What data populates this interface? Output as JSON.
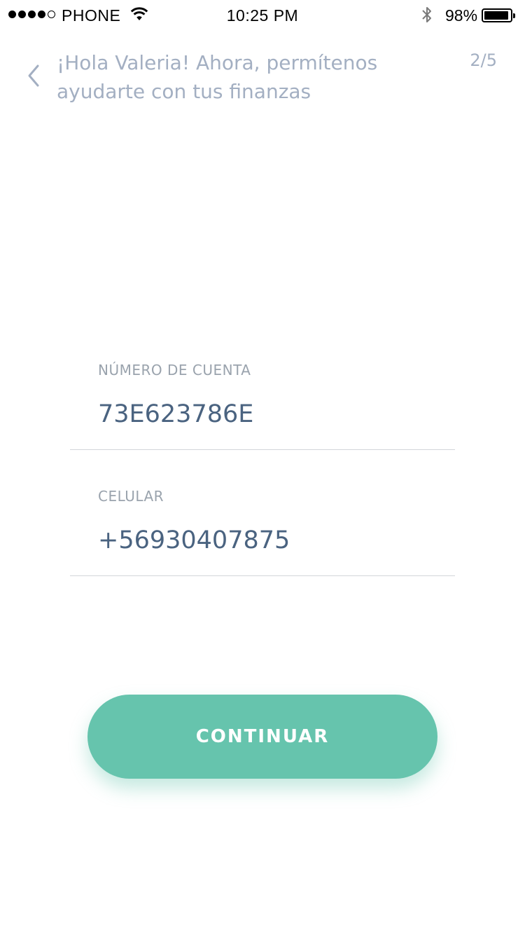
{
  "status_bar": {
    "carrier": "PHONE",
    "time": "10:25 PM",
    "battery_percent": "98%",
    "signal_dots_filled": 4,
    "signal_dots_total": 5,
    "battery_level": 0.98
  },
  "header": {
    "title": "¡Hola Valeria! Ahora, permítenos ayudarte con tus finanzas",
    "step": "2/5",
    "back_icon": "chevron-left-icon"
  },
  "form": {
    "account": {
      "label": "NÚMERO DE CUENTA",
      "value": "73E623786E"
    },
    "phone": {
      "label": "CELULAR",
      "value": "+56930407875"
    }
  },
  "actions": {
    "continue_label": "CONTINUAR"
  },
  "colors": {
    "accent": "#66c4ad",
    "header_text": "#a3afc2",
    "label_text": "#9aa3ad",
    "value_text": "#4a6380"
  }
}
